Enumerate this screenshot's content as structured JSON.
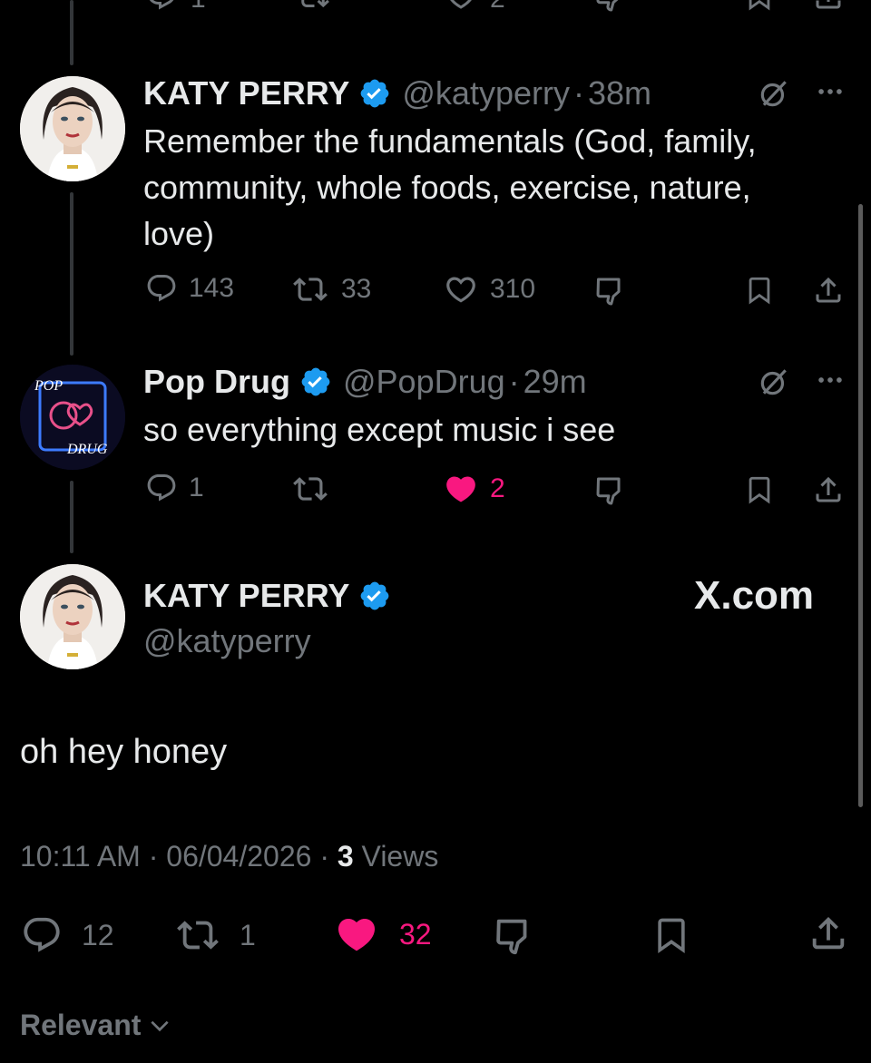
{
  "colors": {
    "background": "#000000",
    "text": "#e7e9ea",
    "muted": "#71767b",
    "like": "#f91880",
    "verified": "#1d9bf0"
  },
  "tweet1": {
    "name": "KATY PERRY",
    "handle": "@katyperry",
    "time": "38m",
    "text_lines": [
      "Remember the fundamentals (God, family,",
      "community, whole foods, exercise, nature,",
      "love)"
    ],
    "replies": "143",
    "retweets": "33",
    "likes": "310"
  },
  "tweet2": {
    "name": "Pop Drug",
    "handle": "@PopDrug",
    "time": "29m",
    "text": "so everything except music i see",
    "replies": "1",
    "retweets": "",
    "likes": "2",
    "avatar_text_top": "POP",
    "avatar_text_bottom": "DRUG"
  },
  "main": {
    "name": "KATY PERRY",
    "handle": "@katyperry",
    "watermark": "X.com",
    "text": "oh hey honey",
    "time": "10:11 AM",
    "date": "06/04/2026",
    "views_count": "3",
    "views_label": "Views",
    "replies": "12",
    "retweets": "1",
    "likes": "32"
  },
  "sort": {
    "label": "Relevant"
  },
  "top_partial": {
    "replies": "1",
    "likes": "2"
  },
  "icons": [
    "reply-icon",
    "retweet-icon",
    "like-icon",
    "dislike-icon",
    "bookmark-icon",
    "share-icon",
    "grok-icon",
    "more-icon",
    "verified-icon",
    "chevron-down-icon"
  ]
}
